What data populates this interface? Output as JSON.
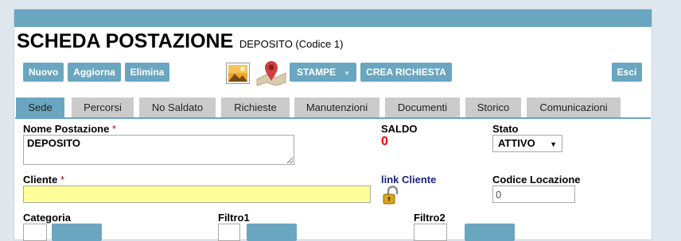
{
  "header": {
    "title": "SCHEDA POSTAZIONE",
    "subtitle": "DEPOSITO (Codice 1)"
  },
  "toolbar": {
    "nuovo": "Nuovo",
    "aggiorna": "Aggiorna",
    "elimina": "Elimina",
    "stampe": "STAMPE",
    "crea_richiesta": "CREA RICHIESTA",
    "esci": "Esci",
    "accent_color": "#6aa6bf"
  },
  "tabs": [
    {
      "label": "Sede",
      "active": true
    },
    {
      "label": "Percorsi"
    },
    {
      "label": "No Saldato"
    },
    {
      "label": "Richieste"
    },
    {
      "label": "Manutenzioni"
    },
    {
      "label": "Documenti"
    },
    {
      "label": "Storico"
    },
    {
      "label": "Comunicazioni"
    }
  ],
  "form": {
    "nome_postazione": {
      "label": "Nome Postazione",
      "required": "*",
      "value": "DEPOSITO"
    },
    "saldo": {
      "label": "SALDO",
      "value": "0"
    },
    "stato": {
      "label": "Stato",
      "value": "ATTIVO"
    },
    "cliente": {
      "label": "Cliente",
      "required": "*",
      "value": ""
    },
    "link_cliente": "link Cliente",
    "codice_locazione": {
      "label": "Codice Locazione",
      "value": "0"
    },
    "categoria": {
      "label": "Categoria"
    },
    "filtro1": {
      "label": "Filtro1"
    },
    "filtro2": {
      "label": "Filtro2"
    }
  }
}
